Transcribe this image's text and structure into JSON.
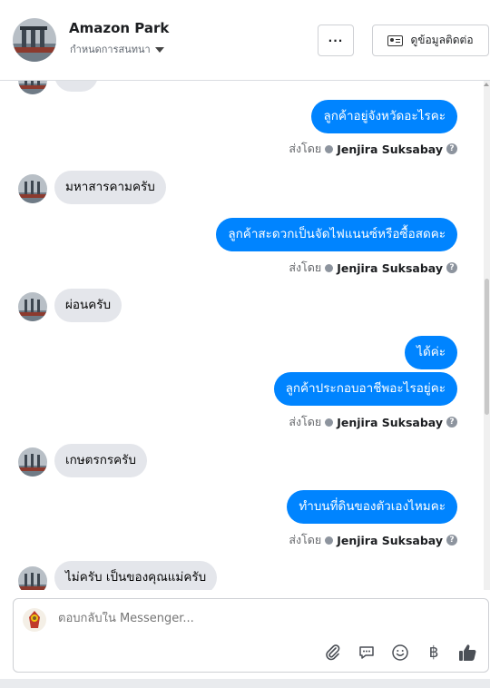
{
  "header": {
    "page_name": "Amazon Park",
    "assign_label": "กำหนดการสนทนา",
    "more_label": "···",
    "contact_label": "ดูข้อมูลติดต่อ"
  },
  "thread": {
    "messages": [
      {
        "dir": "out",
        "text": "ลูกค้าอยู่จังหวัดอะไรคะ"
      },
      {
        "dir": "meta",
        "prefix": "ส่งโดย",
        "name": "Jenjira Suksabay"
      },
      {
        "dir": "in",
        "text": "มหาสารคามครับ"
      },
      {
        "dir": "out",
        "text": "ลูกค้าสะดวกเป็นจัดไฟแนนซ์หรือซื้อสดคะ"
      },
      {
        "dir": "meta",
        "prefix": "ส่งโดย",
        "name": "Jenjira Suksabay"
      },
      {
        "dir": "in",
        "text": "ผ่อนครับ"
      },
      {
        "dir": "out",
        "text": "ได้ค่ะ"
      },
      {
        "dir": "out",
        "text": "ลูกค้าประกอบอาชีพอะไรอยู่คะ"
      },
      {
        "dir": "meta",
        "prefix": "ส่งโดย",
        "name": "Jenjira Suksabay"
      },
      {
        "dir": "in",
        "text": "เกษตรกรครับ"
      },
      {
        "dir": "out",
        "text": "ทำบนที่ดินของตัวเองไหมคะ"
      },
      {
        "dir": "meta",
        "prefix": "ส่งโดย",
        "name": "Jenjira Suksabay"
      },
      {
        "dir": "in",
        "text": "ไม่ครับ เป็นของคุณแม่ครับ"
      }
    ]
  },
  "composer": {
    "placeholder": "ตอบกลับใน Messenger...",
    "tools": [
      "attach-icon",
      "saved-reply-icon",
      "emoji-icon",
      "baht-payment-icon",
      "like-icon"
    ],
    "baht_symbol": "฿"
  },
  "colors": {
    "outgoing_bubble": "#0084ff",
    "incoming_bubble": "#e4e6eb"
  }
}
